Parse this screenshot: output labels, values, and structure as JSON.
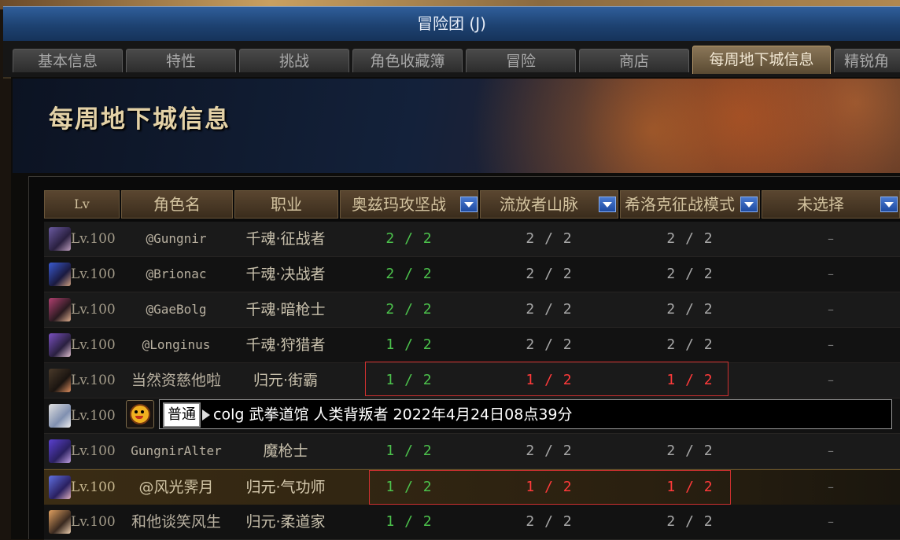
{
  "window": {
    "title": "冒险团 (J)"
  },
  "tabs": [
    {
      "label": "基本信息",
      "active": false
    },
    {
      "label": "特性",
      "active": false
    },
    {
      "label": "挑战",
      "active": false
    },
    {
      "label": "角色收藏簿",
      "active": false
    },
    {
      "label": "冒险",
      "active": false
    },
    {
      "label": "商店",
      "active": false
    },
    {
      "label": "每周地下城信息",
      "active": true
    },
    {
      "label": "精锐角",
      "active": false
    }
  ],
  "banner": {
    "title": "每周地下城信息"
  },
  "table": {
    "headers": {
      "lv": "Lv",
      "name": "角色名",
      "class": "职业",
      "dungeon1": "奥兹玛攻坚战",
      "dungeon2": "流放者山脉",
      "dungeon3": "希洛克征战模式",
      "dungeon4": "未选择"
    },
    "rows": [
      {
        "lv": "Lv.100",
        "name": "@Gungnir",
        "class": "千魂·征战者",
        "d1": "2 / 2",
        "d2": "2 / 2",
        "d3": "2 / 2",
        "d4": "–"
      },
      {
        "lv": "Lv.100",
        "name": "@Brionac",
        "class": "千魂·决战者",
        "d1": "2 / 2",
        "d2": "2 / 2",
        "d3": "2 / 2",
        "d4": "–"
      },
      {
        "lv": "Lv.100",
        "name": "@GaeBolg",
        "class": "千魂·暗枪士",
        "d1": "2 / 2",
        "d2": "2 / 2",
        "d3": "2 / 2",
        "d4": "–"
      },
      {
        "lv": "Lv.100",
        "name": "@Longinus",
        "class": "千魂·狩猎者",
        "d1": "1 / 2",
        "d2": "2 / 2",
        "d3": "2 / 2",
        "d4": "–"
      },
      {
        "lv": "Lv.100",
        "name": "当然资慈他啦",
        "class": "归元·街霸",
        "d1": "1 / 2",
        "d2": "1 / 2",
        "d3": "1 / 2",
        "d4": "–"
      },
      {
        "lv": "Lv.100"
      },
      {
        "lv": "Lv.100",
        "name": "GungnirAlter",
        "class": "魔枪士",
        "d1": "1 / 2",
        "d2": "2 / 2",
        "d3": "2 / 2",
        "d4": "–"
      },
      {
        "lv": "Lv.100",
        "name": "@风光霁月",
        "class": "归元·气功师",
        "d1": "1 / 2",
        "d2": "1 / 2",
        "d3": "1 / 2",
        "d4": "–"
      },
      {
        "lv": "Lv.100",
        "name": "和他谈笑风生",
        "class": "归元·柔道家",
        "d1": "1 / 2",
        "d2": "2 / 2",
        "d3": "2 / 2",
        "d4": "–"
      }
    ]
  },
  "chat": {
    "tag": "普通",
    "message": "colg 武拳道馆 人类背叛者 2022年4月24日08点39分"
  },
  "colors": {
    "complete_green": "#4cc24c",
    "neutral_grey": "#a8a8a8",
    "warning_red": "#ff3a3a",
    "highlight_box": "#d03030"
  }
}
